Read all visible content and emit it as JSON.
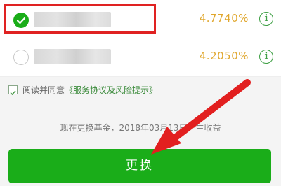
{
  "funds": [
    {
      "name": "",
      "rate": "4.7740%",
      "selected": true
    },
    {
      "name": "",
      "rate": "4.2050%",
      "selected": false
    }
  ],
  "agreement": {
    "prefix": "阅读并同意",
    "link": "《服务协议及风险提示》"
  },
  "notice": "现在更换基金，2018年03月13日产生收益",
  "submit_label": "更换",
  "icons": {
    "selected_radio": "check-circle-icon",
    "info": "info-icon"
  },
  "colors": {
    "accent_green": "#1aad19",
    "rate_color": "#e0a72e",
    "highlight_red": "#e02222"
  }
}
